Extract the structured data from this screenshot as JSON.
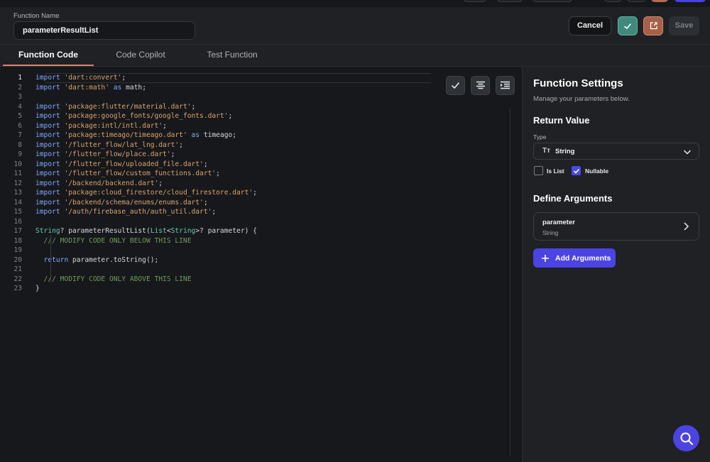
{
  "header": {
    "function_name_label": "Function Name",
    "function_name_value": "parameterResultList",
    "cancel_label": "Cancel",
    "save_label": "Save"
  },
  "tabs": [
    {
      "label": "Function Code",
      "active": true
    },
    {
      "label": "Code Copilot",
      "active": false
    },
    {
      "label": "Test Function",
      "active": false
    }
  ],
  "editor": {
    "current_line": 1,
    "lines": [
      {
        "n": "1",
        "tokens": [
          {
            "t": "import",
            "c": "kw"
          },
          {
            "t": " ",
            "c": "plain"
          },
          {
            "t": "'dart:convert'",
            "c": "str"
          },
          {
            "t": ";",
            "c": "plain"
          }
        ]
      },
      {
        "n": "2",
        "tokens": [
          {
            "t": "import",
            "c": "kw"
          },
          {
            "t": " ",
            "c": "plain"
          },
          {
            "t": "'dart:math'",
            "c": "str"
          },
          {
            "t": " ",
            "c": "plain"
          },
          {
            "t": "as",
            "c": "kw"
          },
          {
            "t": " math;",
            "c": "plain"
          }
        ]
      },
      {
        "n": "3",
        "tokens": []
      },
      {
        "n": "4",
        "tokens": [
          {
            "t": "import",
            "c": "kw"
          },
          {
            "t": " ",
            "c": "plain"
          },
          {
            "t": "'package:flutter/material.dart'",
            "c": "str"
          },
          {
            "t": ";",
            "c": "plain"
          }
        ]
      },
      {
        "n": "5",
        "tokens": [
          {
            "t": "import",
            "c": "kw"
          },
          {
            "t": " ",
            "c": "plain"
          },
          {
            "t": "'package:google_fonts/google_fonts.dart'",
            "c": "str"
          },
          {
            "t": ";",
            "c": "plain"
          }
        ]
      },
      {
        "n": "6",
        "tokens": [
          {
            "t": "import",
            "c": "kw"
          },
          {
            "t": " ",
            "c": "plain"
          },
          {
            "t": "'package:intl/intl.dart'",
            "c": "str"
          },
          {
            "t": ";",
            "c": "plain"
          }
        ]
      },
      {
        "n": "7",
        "tokens": [
          {
            "t": "import",
            "c": "kw"
          },
          {
            "t": " ",
            "c": "plain"
          },
          {
            "t": "'package:timeago/timeago.dart'",
            "c": "str"
          },
          {
            "t": " ",
            "c": "plain"
          },
          {
            "t": "as",
            "c": "kw"
          },
          {
            "t": " timeago;",
            "c": "plain"
          }
        ]
      },
      {
        "n": "8",
        "tokens": [
          {
            "t": "import",
            "c": "kw"
          },
          {
            "t": " ",
            "c": "plain"
          },
          {
            "t": "'/flutter_flow/lat_lng.dart'",
            "c": "str"
          },
          {
            "t": ";",
            "c": "plain"
          }
        ]
      },
      {
        "n": "9",
        "tokens": [
          {
            "t": "import",
            "c": "kw"
          },
          {
            "t": " ",
            "c": "plain"
          },
          {
            "t": "'/flutter_flow/place.dart'",
            "c": "str"
          },
          {
            "t": ";",
            "c": "plain"
          }
        ]
      },
      {
        "n": "10",
        "tokens": [
          {
            "t": "import",
            "c": "kw"
          },
          {
            "t": " ",
            "c": "plain"
          },
          {
            "t": "'/flutter_flow/uploaded_file.dart'",
            "c": "str"
          },
          {
            "t": ";",
            "c": "plain"
          }
        ]
      },
      {
        "n": "11",
        "tokens": [
          {
            "t": "import",
            "c": "kw"
          },
          {
            "t": " ",
            "c": "plain"
          },
          {
            "t": "'/flutter_flow/custom_functions.dart'",
            "c": "str"
          },
          {
            "t": ";",
            "c": "plain"
          }
        ]
      },
      {
        "n": "12",
        "tokens": [
          {
            "t": "import",
            "c": "kw"
          },
          {
            "t": " ",
            "c": "plain"
          },
          {
            "t": "'/backend/backend.dart'",
            "c": "str"
          },
          {
            "t": ";",
            "c": "plain"
          }
        ]
      },
      {
        "n": "13",
        "tokens": [
          {
            "t": "import",
            "c": "kw"
          },
          {
            "t": " ",
            "c": "plain"
          },
          {
            "t": "'package:cloud_firestore/cloud_firestore.dart'",
            "c": "str"
          },
          {
            "t": ";",
            "c": "plain"
          }
        ]
      },
      {
        "n": "14",
        "tokens": [
          {
            "t": "import",
            "c": "kw"
          },
          {
            "t": " ",
            "c": "plain"
          },
          {
            "t": "'/backend/schema/enums/enums.dart'",
            "c": "str"
          },
          {
            "t": ";",
            "c": "plain"
          }
        ]
      },
      {
        "n": "15",
        "tokens": [
          {
            "t": "import",
            "c": "kw"
          },
          {
            "t": " ",
            "c": "plain"
          },
          {
            "t": "'/auth/firebase_auth/auth_util.dart'",
            "c": "str"
          },
          {
            "t": ";",
            "c": "plain"
          }
        ]
      },
      {
        "n": "16",
        "tokens": []
      },
      {
        "n": "17",
        "tokens": [
          {
            "t": "String",
            "c": "type"
          },
          {
            "t": "? parameterResultList(",
            "c": "plain"
          },
          {
            "t": "List",
            "c": "type"
          },
          {
            "t": "<",
            "c": "plain"
          },
          {
            "t": "String",
            "c": "type"
          },
          {
            "t": ">? parameter) {",
            "c": "plain"
          }
        ]
      },
      {
        "n": "18",
        "tokens": [
          {
            "t": "  /// MODIFY CODE ONLY BELOW THIS LINE",
            "c": "cm"
          }
        ]
      },
      {
        "n": "19",
        "tokens": []
      },
      {
        "n": "20",
        "tokens": [
          {
            "t": "  ",
            "c": "plain"
          },
          {
            "t": "return",
            "c": "kw"
          },
          {
            "t": " parameter.toString();",
            "c": "plain"
          }
        ]
      },
      {
        "n": "21",
        "tokens": []
      },
      {
        "n": "22",
        "tokens": [
          {
            "t": "  /// MODIFY CODE ONLY ABOVE THIS LINE",
            "c": "cm"
          }
        ]
      },
      {
        "n": "23",
        "tokens": [
          {
            "t": "}",
            "c": "plain"
          }
        ]
      }
    ]
  },
  "settings": {
    "title": "Function Settings",
    "subtitle": "Manage your parameters below.",
    "return_value_heading": "Return Value",
    "type_label": "Type",
    "type_icon_text": "Tт",
    "type_value": "String",
    "is_list_label": "Is List",
    "is_list_checked": false,
    "nullable_label": "Nullable",
    "nullable_checked": true,
    "define_arguments_heading": "Define Arguments",
    "argument": {
      "name": "parameter",
      "type": "String"
    },
    "add_arguments_label": "Add Arguments"
  },
  "colors": {
    "accent": "#4b44e3",
    "confirm": "#3f8a7c",
    "open_external": "#a76048",
    "tab_underline": "#d9836a"
  }
}
